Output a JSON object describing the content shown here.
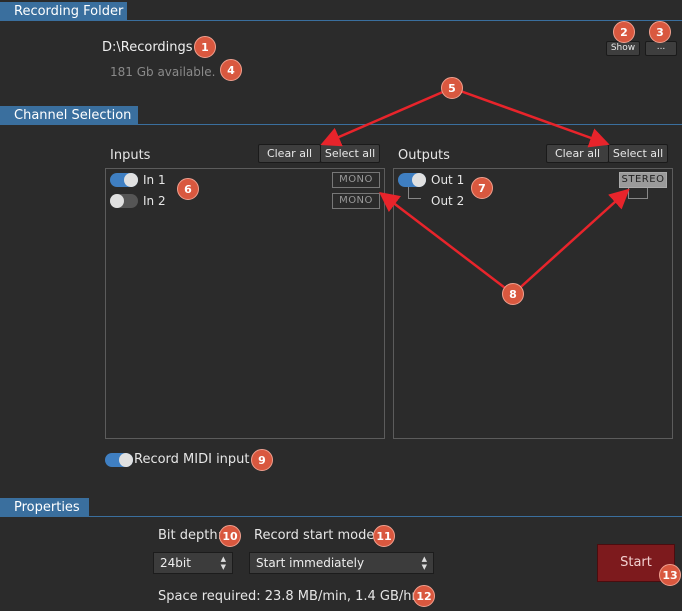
{
  "recording_folder": {
    "title": "Recording Folder",
    "path": "D:\\Recordings",
    "available": "181 Gb available.",
    "show_label": "Show",
    "browse_label": "..."
  },
  "channel_selection": {
    "title": "Channel Selection",
    "inputs": {
      "label": "Inputs",
      "clear_all": "Clear all",
      "select_all": "Select all",
      "channels": [
        {
          "name": "In 1",
          "enabled": true,
          "mode": "MONO"
        },
        {
          "name": "In 2",
          "enabled": false,
          "mode": "MONO"
        }
      ]
    },
    "outputs": {
      "label": "Outputs",
      "clear_all": "Clear all",
      "select_all": "Select all",
      "channels": [
        {
          "name": "Out 1",
          "enabled": true,
          "mode": "STEREO"
        },
        {
          "name": "Out 2"
        }
      ]
    },
    "record_midi": {
      "label": "Record MIDI input",
      "enabled": true
    }
  },
  "properties": {
    "title": "Properties",
    "bit_depth_label": "Bit depth:",
    "bit_depth_value": "24bit",
    "start_mode_label": "Record start mode:",
    "start_mode_value": "Start immediately",
    "space_required": "Space required: 23.8 MB/min, 1.4 GB/hr",
    "start_label": "Start"
  },
  "badges": [
    "1",
    "2",
    "3",
    "4",
    "5",
    "6",
    "7",
    "8",
    "9",
    "10",
    "11",
    "12",
    "13"
  ],
  "colors": {
    "background": "#2b2b2b",
    "section": "#3a6f9e",
    "toggle_on": "#3f7fc2",
    "badge": "#d9583f",
    "arrow": "#e8242b",
    "start": "#7d1a1d"
  }
}
